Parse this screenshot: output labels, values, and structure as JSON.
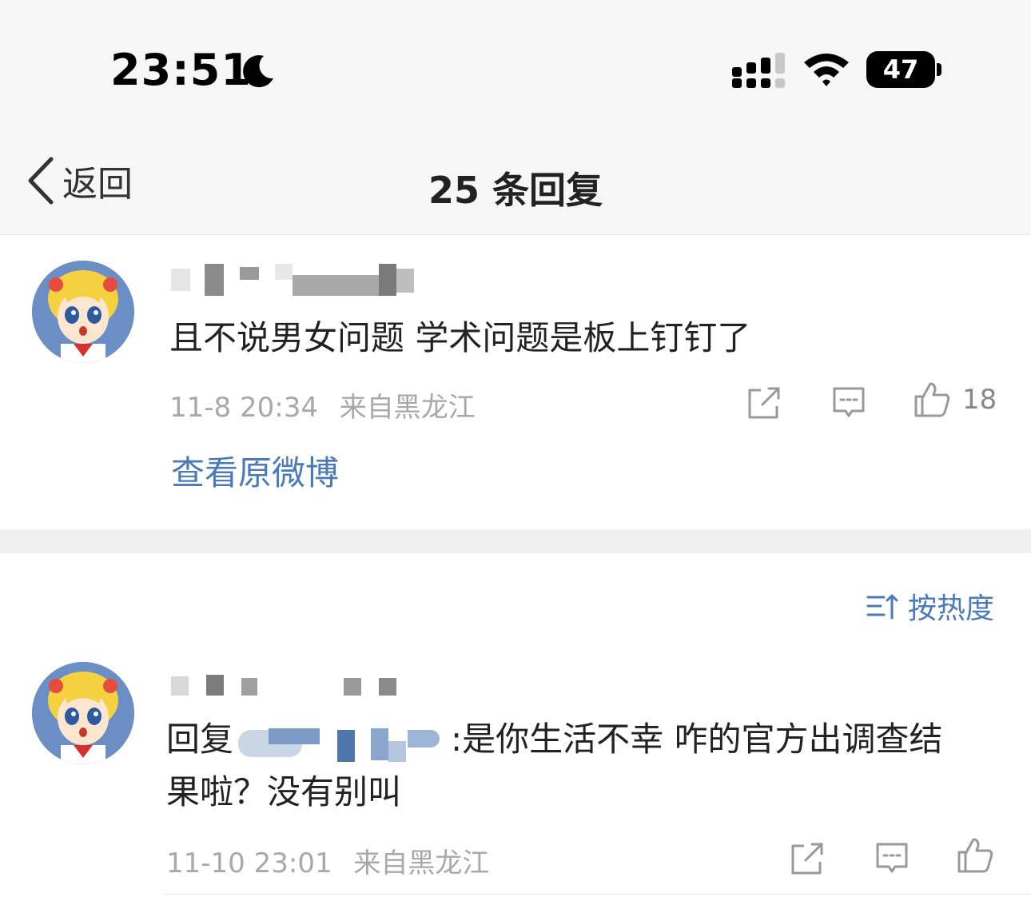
{
  "status_bar": {
    "time": "23:51",
    "battery": "47"
  },
  "nav": {
    "back_label": "返回",
    "title": "25 条回复"
  },
  "main_comment": {
    "text": "且不说男女问题 学术问题是板上钉钉了",
    "timestamp": "11-8 20:34",
    "location": "来自黑龙江",
    "like_count": "18",
    "view_original": "查看原微博"
  },
  "sort": {
    "label": "按热度"
  },
  "reply": {
    "prefix": "回复",
    "text_line1": ":是你生活不幸 咋的官方出调查结",
    "text_line2": "果啦？没有别叫",
    "timestamp": "11-10 23:01",
    "location": "来自黑龙江"
  },
  "colors": {
    "link_blue": "#4a7ab8",
    "meta_gray": "#a8a8a8",
    "header_bg": "#f6f6f6"
  },
  "icons": [
    "moon-icon",
    "signal-icon",
    "wifi-icon",
    "battery-icon",
    "back-chevron-icon",
    "share-icon",
    "comment-icon",
    "like-icon",
    "sort-icon"
  ]
}
